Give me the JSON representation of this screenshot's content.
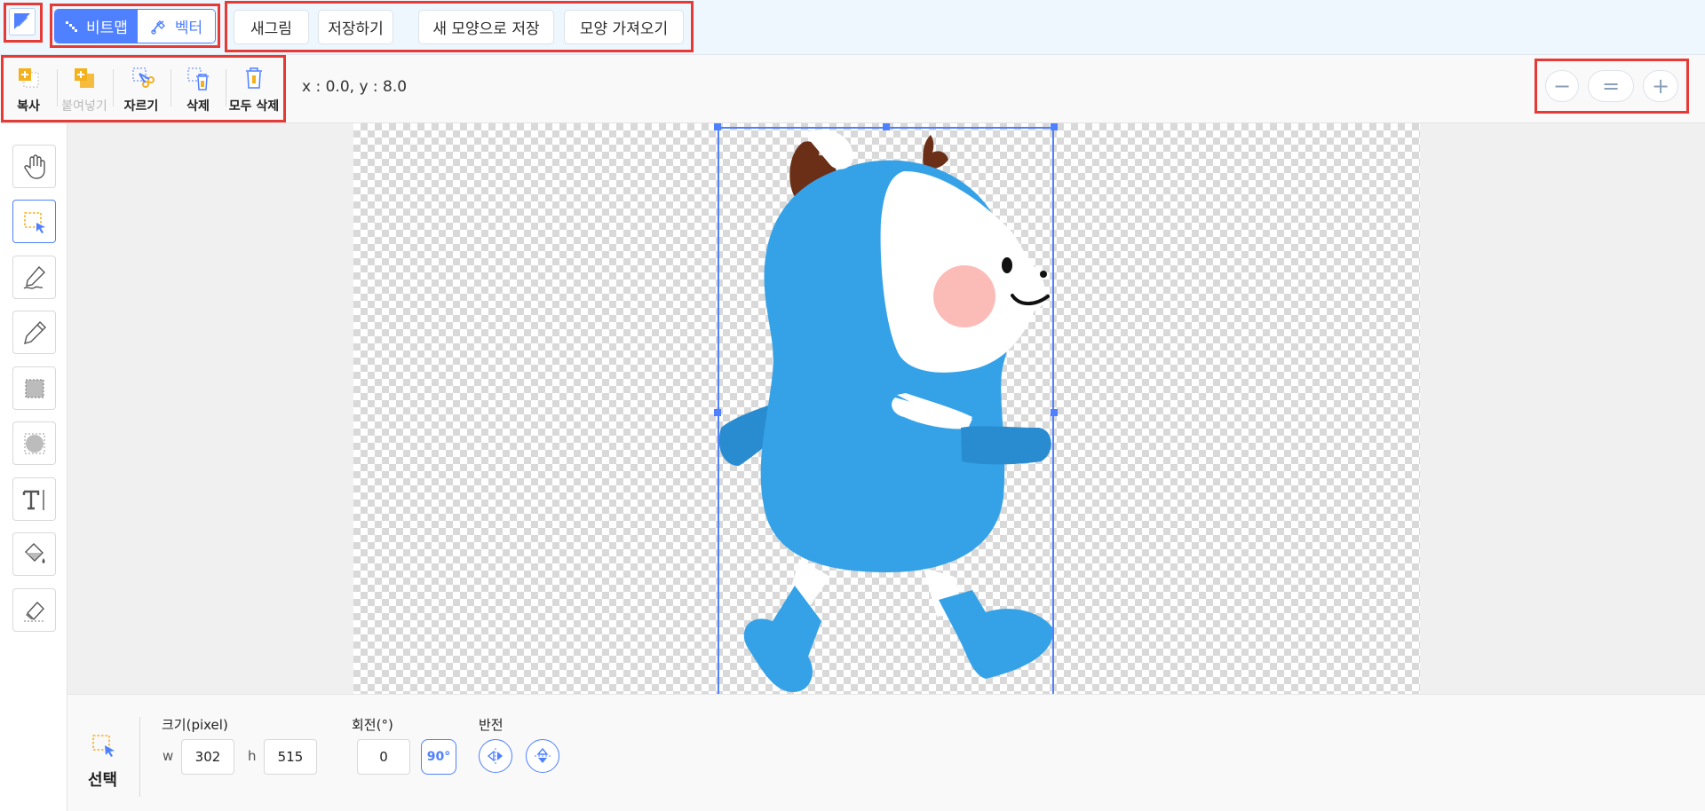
{
  "header": {
    "mode_segment": {
      "bitmap_label": "비트맵",
      "vector_label": "벡터"
    },
    "buttons": {
      "new_drawing": "새그림",
      "save": "저장하기",
      "save_as_new_shape": "새 모양으로 저장",
      "import_shape": "모양 가져오기"
    }
  },
  "edit_toolbar": {
    "copy": "복사",
    "paste": "붙여넣기",
    "cut": "자르기",
    "delete": "삭제",
    "delete_all": "모두 삭제",
    "coordinates": "x : 0.0, y : 8.0"
  },
  "zoom": {
    "zoom_out": "−",
    "reset": "=",
    "zoom_in": "+"
  },
  "tools": [
    "hand-icon",
    "select-icon",
    "brush-icon",
    "pencil-icon",
    "rectangle-icon",
    "circle-icon",
    "text-icon",
    "fill-icon",
    "eraser-icon"
  ],
  "properties": {
    "tool_name": "선택",
    "size_label": "크기(pixel)",
    "w_label": "w",
    "w_value": "302",
    "h_label": "h",
    "h_value": "515",
    "rotation_label": "회전(°)",
    "rotation_value": "0",
    "rotate_90_label": "90°",
    "flip_label": "반전"
  },
  "colors": {
    "accent": "#4f80ff",
    "highlight": "#e53a35",
    "character_blue": "#35a2e8",
    "blush": "#fbbcb8",
    "antler": "#6b2f17"
  }
}
